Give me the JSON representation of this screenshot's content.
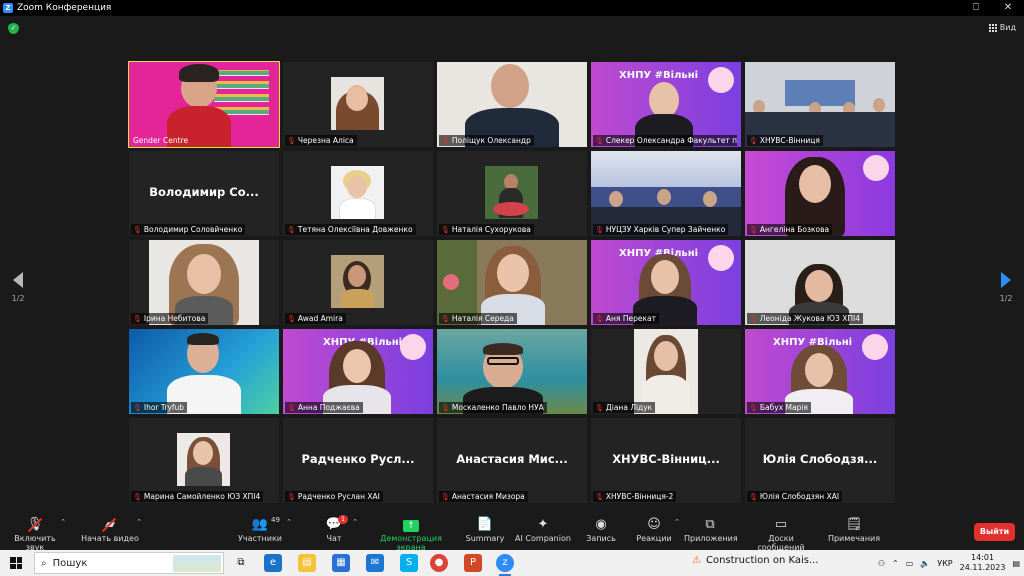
{
  "window": {
    "title": "Zoom Конференция",
    "controls": [
      "⎕",
      "✕"
    ]
  },
  "topbar": {
    "view_label": "Вид"
  },
  "gallery": {
    "tiles": [
      {
        "name": "Gender Centre",
        "big": "",
        "active": true
      },
      {
        "name": "Черезна Аліса",
        "big": ""
      },
      {
        "name": "Поліщук Олександр",
        "big": ""
      },
      {
        "name": "Слекер Олександра Факультет п",
        "big": ""
      },
      {
        "name": "ХНУВС-Вінниця",
        "big": ""
      },
      {
        "name": "Володимир Соловйченко",
        "big": "Володимир Со..."
      },
      {
        "name": "Тетяна Олексіївна Довженко",
        "big": ""
      },
      {
        "name": "Наталія Сухорукова",
        "big": ""
      },
      {
        "name": "НУЦЗУ Харків Супер Зайченко",
        "big": ""
      },
      {
        "name": "Ангеліна Бозкова",
        "big": ""
      },
      {
        "name": "Ірина Небитова",
        "big": ""
      },
      {
        "name": "Awad Amira",
        "big": ""
      },
      {
        "name": "Наталія Середа",
        "big": ""
      },
      {
        "name": "Аня Перекат",
        "big": ""
      },
      {
        "name": "Леоніда Жукова ЮЗ ХПІ4",
        "big": ""
      },
      {
        "name": "Ihor Tryfub",
        "big": ""
      },
      {
        "name": "Анна Поджаєва",
        "big": ""
      },
      {
        "name": "Москаленко Павло НУА",
        "big": ""
      },
      {
        "name": "Діана Лідук",
        "big": ""
      },
      {
        "name": "Бабух Марія",
        "big": ""
      },
      {
        "name": "Марина Самойленко ЮЗ ХПІ4",
        "big": ""
      },
      {
        "name": "Радченко Руслан ХАІ",
        "big": "Радченко Русл..."
      },
      {
        "name": "Анастасия Мизора",
        "big": "Анастасия Мис..."
      },
      {
        "name": "ХНУВС-Вінниця-2",
        "big": "ХНУВС-Вінниц..."
      },
      {
        "name": "Юлія Слободзян ХАІ",
        "big": "Юлія Слободзя..."
      }
    ],
    "page_left": "1/2",
    "page_right": "1/2"
  },
  "toolbar": {
    "mute": "Включить звук",
    "video": "Начать видео",
    "participants": "Участники",
    "participants_count": "49",
    "chat": "Чат",
    "chat_badge": "1",
    "share": "Демонстрация экрана",
    "summary": "Summary",
    "companion": "AI Companion",
    "record": "Запись",
    "reactions": "Реакции",
    "apps": "Приложения",
    "whiteboards": "Доски сообщений",
    "notes": "Примечания",
    "leave": "Выйти"
  },
  "taskbar": {
    "search_placeholder": "Пошук",
    "weather_text": "Construction on Kais...",
    "lang": "УКР",
    "time": "14:01",
    "date": "24.11.2023"
  },
  "colors": {
    "accent": "#2d8cff",
    "leave": "#e0312c",
    "share_green": "#23d160",
    "active_outline": "#d8e63a"
  }
}
